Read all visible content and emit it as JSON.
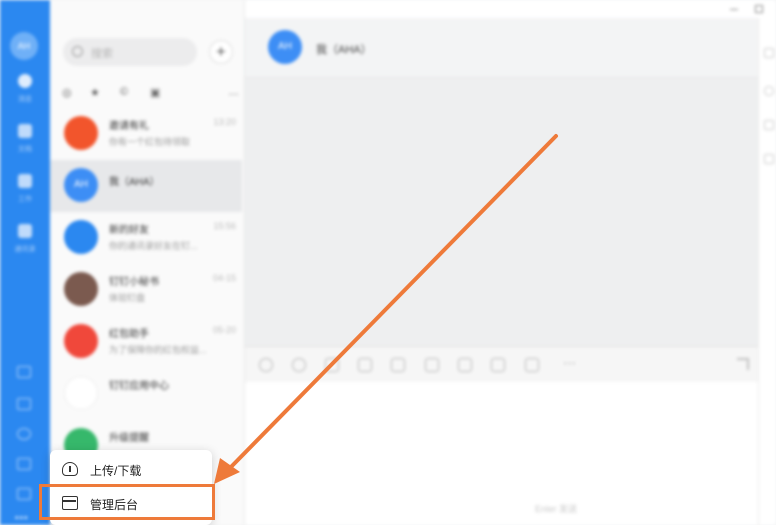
{
  "rail": {
    "avatar_text": "AH",
    "items": [
      {
        "label": "消息"
      },
      {
        "label": "文档"
      },
      {
        "label": "工作"
      },
      {
        "label": "通讯录"
      }
    ]
  },
  "list": {
    "search_placeholder": "搜索",
    "add_label": "+",
    "conversations": [
      {
        "name": "邀请有礼",
        "preview": "你有一个红包待领取",
        "time": "13:20",
        "avatar": "",
        "color": "#f2552c"
      },
      {
        "name": "我（AHA）",
        "preview": "",
        "time": "",
        "avatar": "AH",
        "color": "#3d8ef5"
      },
      {
        "name": "新的好友",
        "preview": "你的通讯录好友在钉...",
        "time": "15:56",
        "avatar": "",
        "color": "#2b88f0"
      },
      {
        "name": "钉钉小秘书",
        "preview": "体验钉盘",
        "time": "04-15",
        "avatar": "",
        "color": "#7b5a4f"
      },
      {
        "name": "红包助手",
        "preview": "为了保障你的红包权益...",
        "time": "05-20",
        "avatar": "",
        "color": "#f0483b"
      },
      {
        "name": "钉钉应用中心",
        "preview": "",
        "time": "",
        "avatar": "",
        "color": "#ffffff"
      },
      {
        "name": "升级提醒",
        "preview": "",
        "time": "",
        "avatar": "",
        "color": "#36b86b"
      }
    ]
  },
  "chat": {
    "avatar_text": "AH",
    "title": "我（AHA）",
    "composer_hint": "Enter 发送"
  },
  "popup": {
    "items": [
      {
        "label": "上传/下载",
        "icon": "cloud-upload-download-icon"
      },
      {
        "label": "管理后台",
        "icon": "admin-console-icon"
      }
    ]
  },
  "colors": {
    "brand": "#2b88f0",
    "annotation": "#ee7a3a"
  }
}
